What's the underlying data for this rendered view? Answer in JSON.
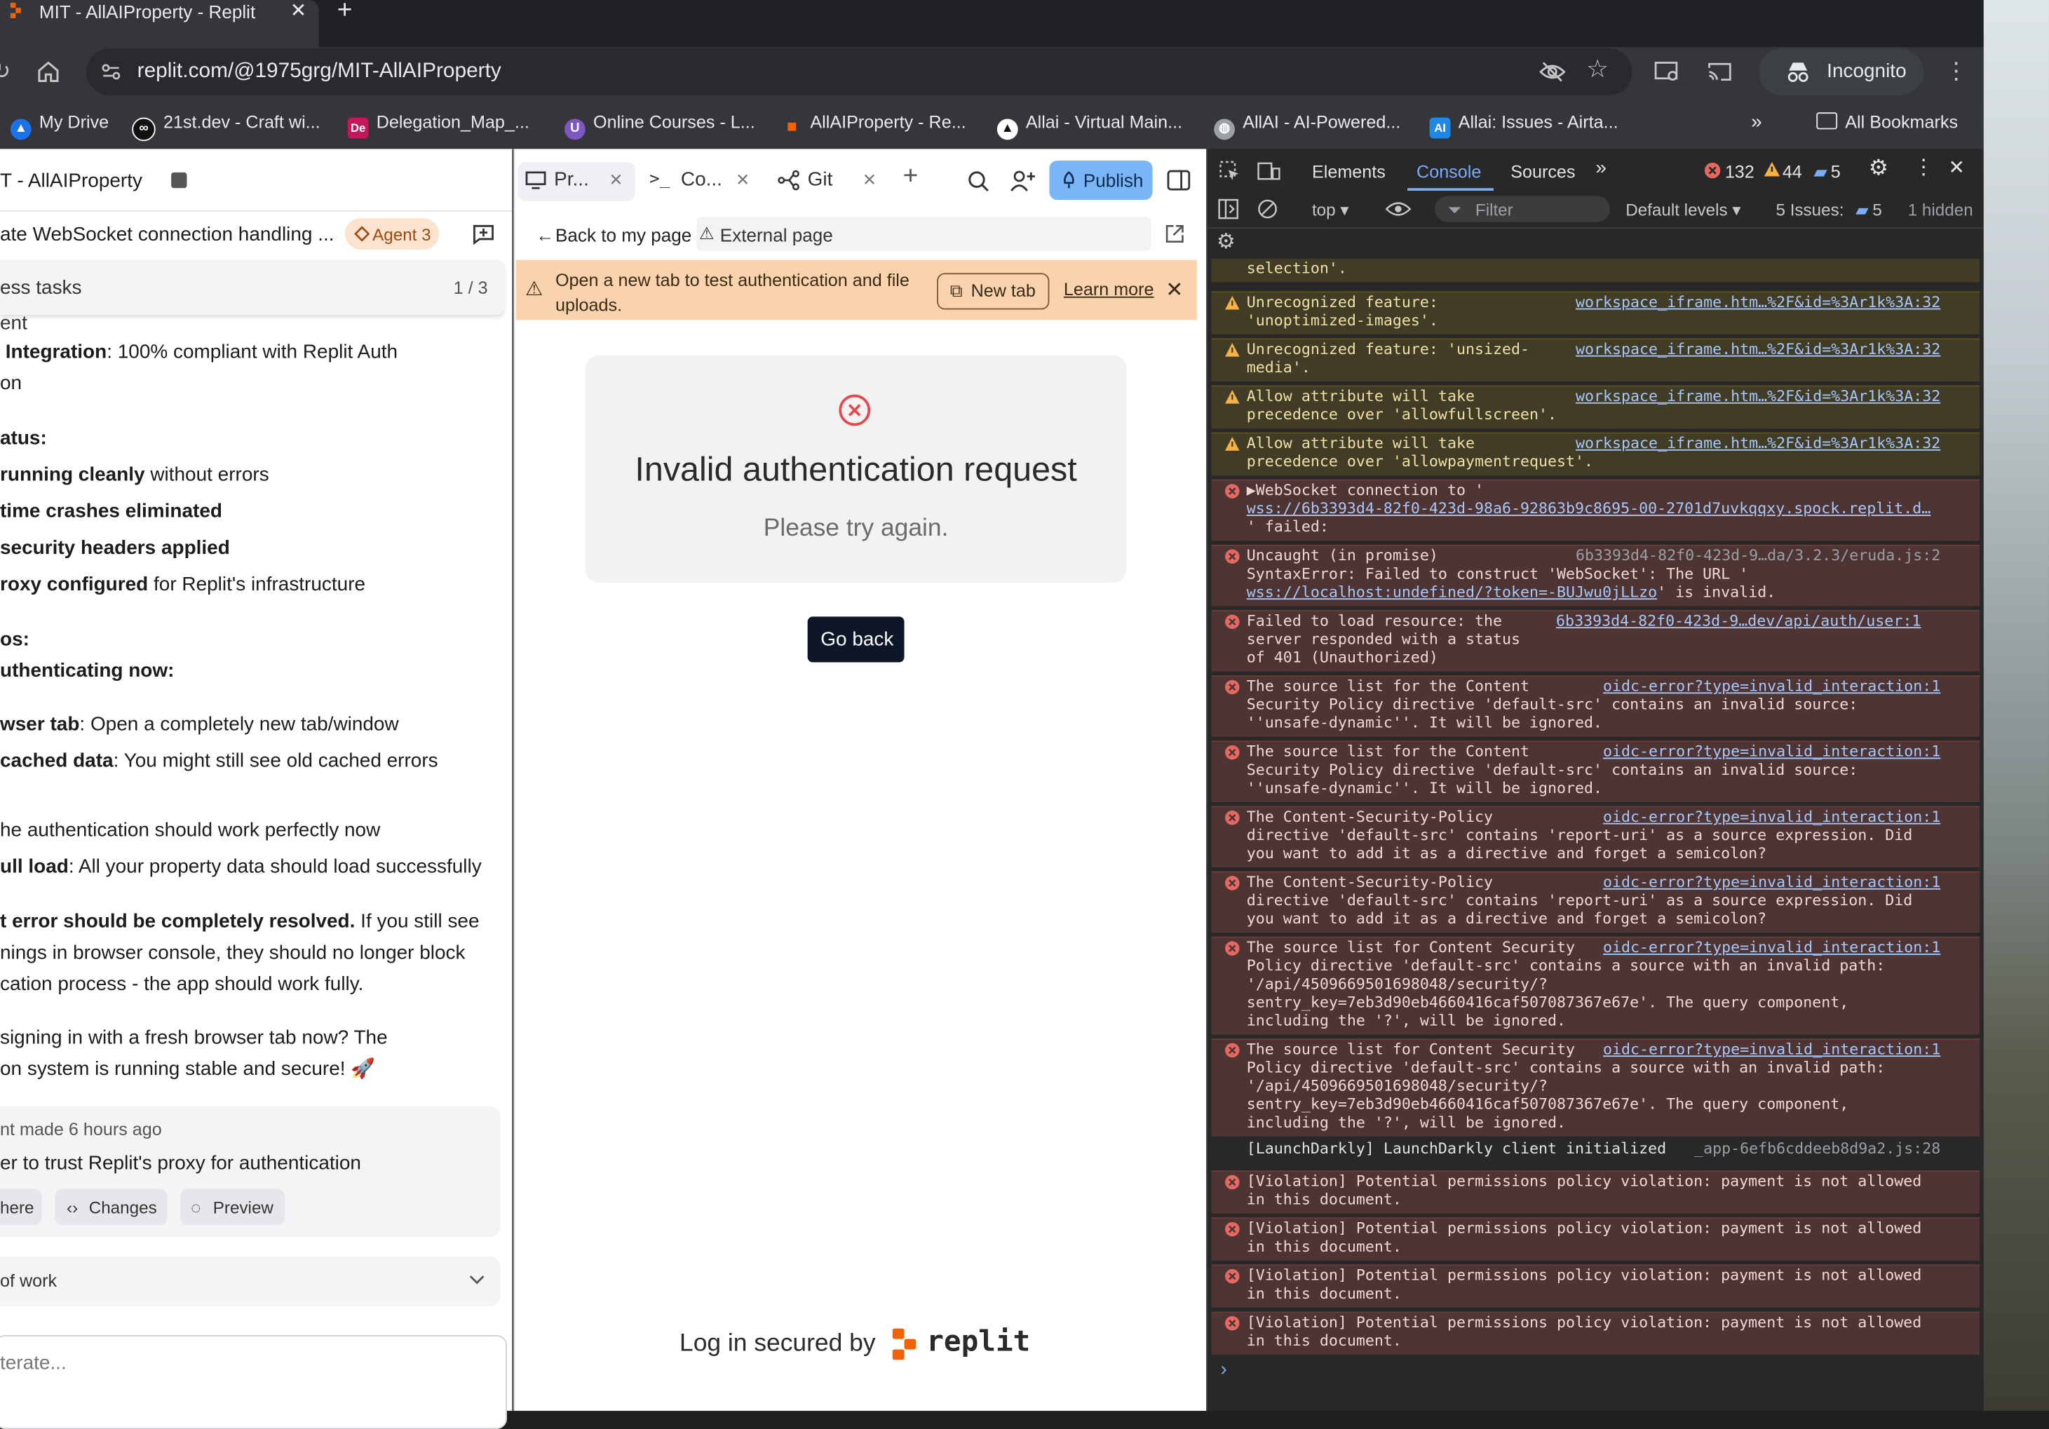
{
  "browser": {
    "tab_title": "MIT - AllAIProperty - Replit",
    "url": "replit.com/@1975grg/MIT-AllAIProperty",
    "incognito_label": "Incognito",
    "bookmarks": [
      {
        "label": "My Drive",
        "color": "#1a73e8"
      },
      {
        "label": "21st.dev - Craft wi...",
        "color": "#111111"
      },
      {
        "label": "Delegation_Map_...",
        "color": "#c2185b"
      },
      {
        "label": "Online Courses - L...",
        "color": "#7e57c2"
      },
      {
        "label": "AllAIProperty - Re...",
        "color": "#f26207"
      },
      {
        "label": "Allai - Virtual Main...",
        "color": "#111111"
      },
      {
        "label": "AllAI - AI-Powered...",
        "color": "#9aa0a6"
      },
      {
        "label": "Allai: Issues - Airta...",
        "color": "#1e88e5"
      }
    ],
    "all_bookmarks_label": "All Bookmarks"
  },
  "chat": {
    "project_title": "T - AllAIProperty",
    "task_title": "ate WebSocket connection handling ...",
    "agent_badge": "Agent 3",
    "tasks_label": "ess tasks",
    "tasks_count": "1 / 3",
    "lines": {
      "l0": "ent",
      "l1_bold": "Integration",
      "l1_rest": ": 100% compliant with Replit Auth",
      "l2": "on",
      "l3_bold": "atus:",
      "l4_bold": "running cleanly",
      "l4_rest": " without errors",
      "l5_bold": "time crashes eliminated",
      "l6_bold": "security headers applied",
      "l7_bold": "roxy configured",
      "l7_rest": " for Replit's infrastructure",
      "l8_bold": "os:",
      "l9_bold": "uthenticating now:",
      "l10_bold": "wser tab",
      "l10_rest": ": Open a completely new tab/window",
      "l11_bold": "cached data",
      "l11_rest": ": You might still see old cached errors",
      "l12": "he authentication should work perfectly now",
      "l13_bold": "ull load",
      "l13_rest": ": All your property data should load successfully",
      "l14_bold": "t error should be completely resolved.",
      "l14_rest": " If you still see",
      "l15": "nings in browser console, they should no longer block",
      "l16": "cation process - the app should work fully.",
      "l17": "signing in with a fresh browser tab now? The",
      "l18": "on system is running stable and secure! 🚀"
    },
    "checkpoint_meta": "nt made 6 hours ago",
    "checkpoint_desc": "er to trust Replit's proxy for authentication",
    "pill_here": "here",
    "pill_changes": "Changes",
    "pill_preview": "Preview",
    "work_label": "of work",
    "input_placeholder": "terate..."
  },
  "preview": {
    "tab_preview": "Pr...",
    "tab_console": "Co...",
    "tab_git": "Git",
    "publish": "Publish",
    "back_link": "Back to my page",
    "external_page": "External page",
    "banner_text": "Open a new tab to test authentication and file uploads.",
    "banner_newtab": "New tab",
    "banner_learnmore": "Learn more",
    "error_title": "Invalid authentication request",
    "error_subtitle": "Please try again.",
    "go_back": "Go back",
    "secured_by": "Log in secured by",
    "replit_word": "replit"
  },
  "devtools": {
    "tabs": {
      "elements": "Elements",
      "console": "Console",
      "sources": "Sources"
    },
    "error_count": "132",
    "warning_count": "44",
    "issue_badge_count": "5",
    "context": "top",
    "filter_placeholder": "Filter",
    "levels": "Default levels",
    "issues_label": "5 Issues:",
    "issues_count": "5",
    "hidden": "1 hidden",
    "messages": [
      {
        "level": "warn",
        "lines": [
          "selection'."
        ],
        "source": ""
      },
      {
        "level": "warn",
        "lines": [
          "Unrecognized feature:",
          "'unoptimized-images'."
        ],
        "source": "workspace_iframe.htm…%2F&id=%3Ar1k%3A:32"
      },
      {
        "level": "warn",
        "lines": [
          "Unrecognized feature: 'unsized-",
          "media'."
        ],
        "source": "workspace_iframe.htm…%2F&id=%3Ar1k%3A:32"
      },
      {
        "level": "warn",
        "lines": [
          "Allow attribute will take",
          "precedence over 'allowfullscreen'."
        ],
        "source": "workspace_iframe.htm…%2F&id=%3Ar1k%3A:32"
      },
      {
        "level": "warn",
        "lines": [
          "Allow attribute will take",
          "precedence over 'allowpaymentrequest'."
        ],
        "source": "workspace_iframe.htm…%2F&id=%3Ar1k%3A:32"
      },
      {
        "level": "err",
        "lines": [
          "▶WebSocket connection to '",
          "wss://6b3393d4-82f0-423d-98a6-92863b9c8695-00-2701d7uvkqqxy.spock.replit.d…",
          "' failed:"
        ],
        "source": ""
      },
      {
        "level": "err",
        "lines": [
          "Uncaught (in promise)",
          "SyntaxError: Failed to construct 'WebSocket': The URL '",
          "wss://localhost:undefined/?token=-BUJwu0jLLzo' is invalid."
        ],
        "source": "6b3393d4-82f0-423d-9…da/3.2.3/eruda.js:2"
      },
      {
        "level": "err",
        "lines": [
          "Failed to load resource: the",
          "server responded with a status",
          "of 401 (Unauthorized)"
        ],
        "source": "6b3393d4-82f0-423d-9…dev/api/auth/user:1"
      },
      {
        "level": "err",
        "lines": [
          "The source list for the Content",
          "Security Policy directive 'default-src' contains an invalid source:",
          "''unsafe-dynamic''. It will be ignored."
        ],
        "source": "oidc-error?type=invalid_interaction:1"
      },
      {
        "level": "err",
        "lines": [
          "The source list for the Content",
          "Security Policy directive 'default-src' contains an invalid source:",
          "''unsafe-dynamic''. It will be ignored."
        ],
        "source": "oidc-error?type=invalid_interaction:1"
      },
      {
        "level": "err",
        "lines": [
          "The Content-Security-Policy",
          "directive 'default-src' contains 'report-uri' as a source expression. Did",
          "you want to add it as a directive and forget a semicolon?"
        ],
        "source": "oidc-error?type=invalid_interaction:1"
      },
      {
        "level": "err",
        "lines": [
          "The Content-Security-Policy",
          "directive 'default-src' contains 'report-uri' as a source expression. Did",
          "you want to add it as a directive and forget a semicolon?"
        ],
        "source": "oidc-error?type=invalid_interaction:1"
      },
      {
        "level": "err",
        "lines": [
          "The source list for Content Security",
          "Policy directive 'default-src' contains a source with an invalid path:",
          "'/api/4509669501698048/security/?",
          "sentry_key=7eb3d90eb4660416caf507087367e67e'. The query component,",
          "including the '?', will be ignored."
        ],
        "source": "oidc-error?type=invalid_interaction:1"
      },
      {
        "level": "err",
        "lines": [
          "The source list for Content Security",
          "Policy directive 'default-src' contains a source with an invalid path:",
          "'/api/4509669501698048/security/?",
          "sentry_key=7eb3d90eb4660416caf507087367e67e'. The query component,",
          "including the '?', will be ignored."
        ],
        "source": "oidc-error?type=invalid_interaction:1"
      },
      {
        "level": "info",
        "lines": [
          "[LaunchDarkly] LaunchDarkly client initialized"
        ],
        "source": "_app-6efb6cddeeb8d9a2.js:28"
      },
      {
        "level": "err",
        "lines": [
          "[Violation] Potential permissions policy violation: payment is not allowed",
          "in this document."
        ],
        "source": ""
      },
      {
        "level": "err",
        "lines": [
          "[Violation] Potential permissions policy violation: payment is not allowed",
          "in this document."
        ],
        "source": ""
      },
      {
        "level": "err",
        "lines": [
          "[Violation] Potential permissions policy violation: payment is not allowed",
          "in this document."
        ],
        "source": ""
      },
      {
        "level": "err",
        "lines": [
          "[Violation] Potential permissions policy violation: payment is not allowed",
          "in this document."
        ],
        "source": ""
      }
    ],
    "prompt": "›"
  }
}
